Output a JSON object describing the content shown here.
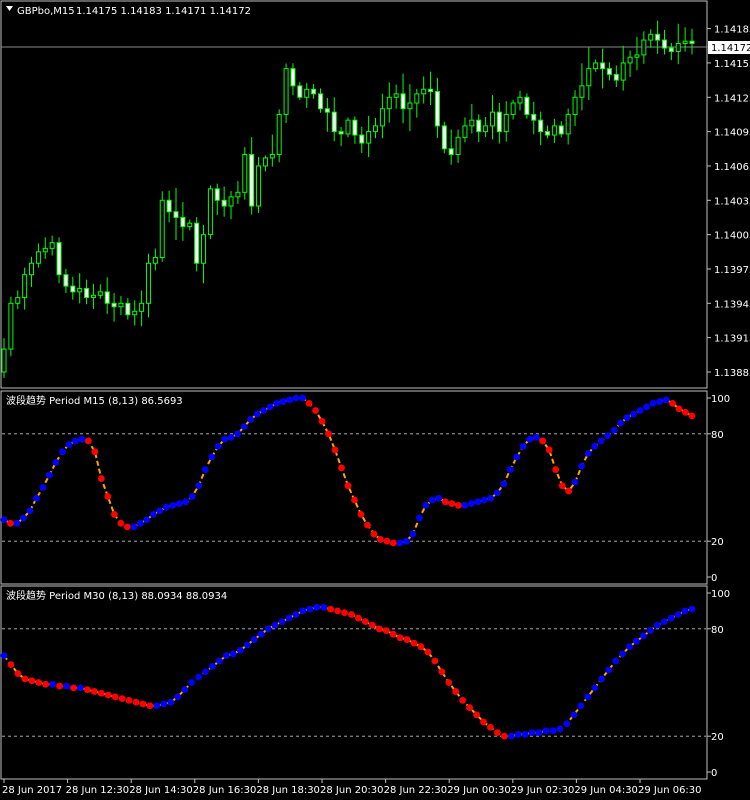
{
  "header": {
    "symbol": "GBPbo,M15",
    "ohlc": "1.14175 1.14183 1.14171 1.14172",
    "current_price": "1.14172"
  },
  "colors": {
    "background": "#000000",
    "frame": "#c0c0c0",
    "candle": "#00ff00",
    "dot_up": "#0000ff",
    "dot_down": "#ff0000",
    "line": "#ffa500",
    "grid": "#c0c0c0"
  },
  "chart_data": [
    {
      "type": "candlestick",
      "title": "GBPbo,M15",
      "ylim": [
        1.13878,
        1.14203
      ],
      "yticks": [
        "1.14185",
        "1.14155",
        "1.14125",
        "1.14095",
        "1.14065",
        "1.14035",
        "1.14005",
        "1.13975",
        "1.13945",
        "1.13915",
        "1.13885"
      ],
      "current_price_line": 1.14172,
      "closes": [
        1.13905,
        1.13945,
        1.1395,
        1.1397,
        1.1398,
        1.1399,
        1.13993,
        1.13998,
        1.1397,
        1.1396,
        1.13955,
        1.13958,
        1.1395,
        1.13952,
        1.13955,
        1.13945,
        1.13942,
        1.13945,
        1.13935,
        1.13938,
        1.13945,
        1.1398,
        1.13985,
        1.14035,
        1.14025,
        1.1402,
        1.14012,
        1.14015,
        1.1398,
        1.14005,
        1.14045,
        1.14035,
        1.1403,
        1.14038,
        1.14042,
        1.14075,
        1.1403,
        1.14065,
        1.14072,
        1.14075,
        1.1411,
        1.1415,
        1.14135,
        1.14125,
        1.14132,
        1.14128,
        1.14115,
        1.14112,
        1.14095,
        1.14093,
        1.14105,
        1.14092,
        1.14085,
        1.14095,
        1.141,
        1.14115,
        1.14125,
        1.14128,
        1.14115,
        1.1412,
        1.14128,
        1.14132,
        1.1413,
        1.141,
        1.1408,
        1.14075,
        1.1409,
        1.141,
        1.14105,
        1.14095,
        1.141,
        1.14112,
        1.14095,
        1.1411,
        1.1412,
        1.14125,
        1.1411,
        1.14105,
        1.14095,
        1.14092,
        1.141,
        1.14093,
        1.1411,
        1.14125,
        1.14135,
        1.1415,
        1.14155,
        1.1415,
        1.14145,
        1.1414,
        1.14155,
        1.1416,
        1.14162,
        1.14175,
        1.1418,
        1.14175,
        1.14168,
        1.14165,
        1.14172,
        1.14174,
        1.14172
      ]
    },
    {
      "type": "line",
      "title": "波段趋势 Period M15 (8,13) 86.5693",
      "ylim": [
        0,
        100
      ],
      "yticks": [
        "100",
        "80",
        "20",
        "0"
      ],
      "levels": [
        80,
        20
      ],
      "series": [
        {
          "values": [
            32,
            30,
            30,
            33,
            37,
            44,
            50,
            57,
            64,
            70,
            74,
            76,
            77,
            76,
            70,
            55,
            45,
            35,
            30,
            28,
            28,
            30,
            32,
            35,
            37,
            39,
            40,
            41,
            42,
            45,
            51,
            60,
            67,
            73,
            77,
            78,
            80,
            84,
            88,
            91,
            93,
            95,
            97,
            98,
            99,
            100,
            100,
            97,
            93,
            87,
            80,
            71,
            61,
            51,
            43,
            35,
            29,
            24,
            21,
            20,
            19,
            19,
            20,
            24,
            33,
            40,
            43,
            44,
            42,
            41,
            40,
            40,
            41,
            42,
            43,
            44,
            47,
            52,
            60,
            67,
            73,
            77,
            78,
            76,
            71,
            60,
            51,
            48,
            53,
            62,
            69,
            73,
            76,
            79,
            82,
            86,
            89,
            91,
            93,
            95,
            97,
            98,
            99,
            97,
            94,
            92,
            90
          ]
        }
      ]
    },
    {
      "type": "line",
      "title": "波段趋势 Period M30 (8,13) 88.0934 88.0934",
      "ylim": [
        0,
        100
      ],
      "yticks": [
        "100",
        "80",
        "20",
        "0"
      ],
      "levels": [
        80,
        20
      ],
      "series": [
        {
          "values": [
            65,
            60,
            55,
            52,
            51,
            50,
            49,
            49,
            48,
            48,
            47,
            47,
            46,
            45,
            44,
            43,
            42,
            41,
            40,
            39,
            38,
            37,
            37,
            38,
            39,
            42,
            46,
            50,
            53,
            56,
            59,
            62,
            65,
            66,
            68,
            71,
            74,
            77,
            80,
            82,
            84,
            86,
            88,
            90,
            91,
            92,
            92,
            91,
            90,
            89,
            88,
            86,
            84,
            82,
            80,
            79,
            77,
            75,
            74,
            72,
            70,
            67,
            62,
            56,
            50,
            45,
            40,
            36,
            32,
            28,
            25,
            22,
            20,
            20,
            21,
            21,
            22,
            22,
            23,
            23,
            24,
            27,
            32,
            37,
            42,
            47,
            52,
            57,
            62,
            66,
            70,
            73,
            76,
            79,
            82,
            84,
            86,
            88,
            90,
            91
          ]
        }
      ]
    }
  ],
  "x_axis": {
    "labels": [
      "28 Jun 2017",
      "28 Jun 12:30",
      "28 Jun 14:30",
      "28 Jun 16:30",
      "28 Jun 18:30",
      "28 Jun 20:30",
      "28 Jun 22:30",
      "29 Jun 00:30",
      "29 Jun 02:30",
      "29 Jun 04:30",
      "29 Jun 06:30"
    ]
  }
}
